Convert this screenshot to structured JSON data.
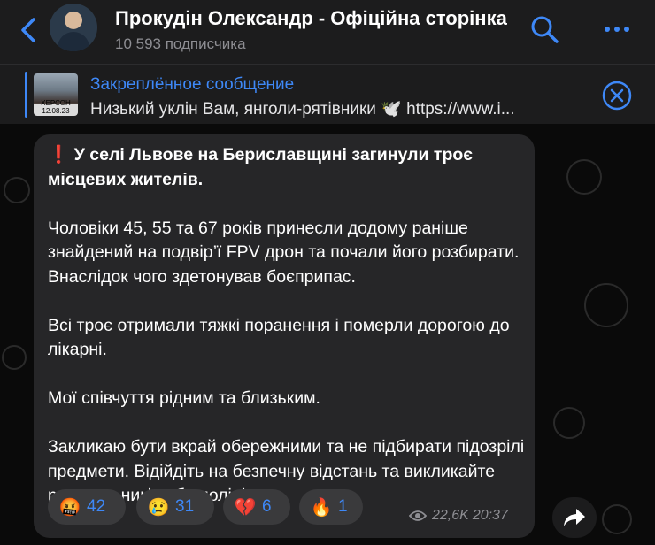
{
  "header": {
    "title": "Прокудін Олександр - Офіційна сторінка",
    "subscribers": "10 593 подписчика"
  },
  "pinned": {
    "title": "Закреплённое сообщение",
    "text": "Низький уклін Вам, янголи-рятівники 🕊️  https://www.i...",
    "thumb_caption": "ХЕРСОН 12.08.23"
  },
  "message": {
    "alert_icon": "❗",
    "headline": "У селі Львове на Бериславщині загинули троє місцевих жителів.",
    "paragraphs": [
      "Чоловіки 45, 55 та 67 років принесли додому раніше знайдений на подвір’ї FPV дрон та почали його розбирати. Внаслідок чого здетонував боєприпас.",
      "Всі троє отримали тяжкі поранення і померли дорогою до лікарні.",
      "Мої співчуття рідним та близьким.",
      "Закликаю бути вкрай обережними та не підбирати підозрілі предмети. Відійдіть на безпечну відстань та викликайте рятувальників або поліцію."
    ],
    "reactions": [
      {
        "emoji": "🤬",
        "count": "42"
      },
      {
        "emoji": "😢",
        "count": "31"
      },
      {
        "emoji": "💔",
        "count": "6"
      },
      {
        "emoji": "🔥",
        "count": "1"
      }
    ],
    "views": "22,6K",
    "time": "20:37"
  },
  "colors": {
    "accent": "#3e88f7",
    "bubble": "#262628",
    "header": "#1c1c1d"
  },
  "icons": [
    "back-chevron-icon",
    "search-icon",
    "more-icon",
    "close-icon",
    "eye-icon",
    "share-icon"
  ]
}
